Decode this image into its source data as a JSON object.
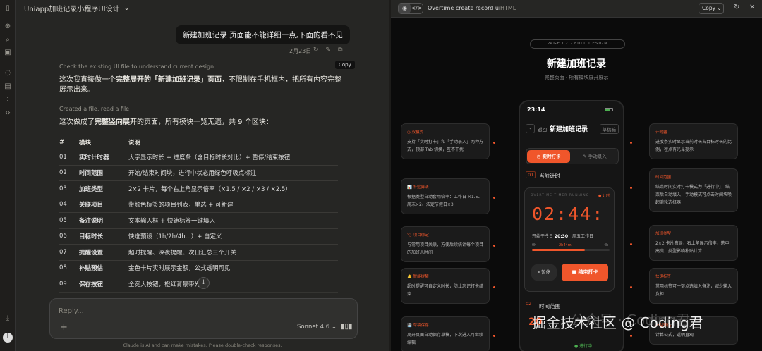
{
  "app": {
    "conversation_title": "Uniapp加班记录小程序UI设计",
    "user_message": "新建加班记录 页面能不能详细一点,下面的看不见",
    "message_date": "2月23日",
    "tooltip": "Copy",
    "step1": "Check the existing UI file to understand current design",
    "para1_a": "这次我直接做一个",
    "para1_b": "完整展开的「新建加班记录」页面",
    "para1_c": "，不限制在手机框内，把所有内容完整展示出来。",
    "step2": "Created a file, read a file",
    "para2_a": "这次做成了",
    "para2_b": "完整竖向展开",
    "para2_c": "的页面，所有模块一览无遗，共 9 个区块：",
    "table": {
      "headers": [
        "#",
        "模块",
        "说明"
      ],
      "rows": [
        [
          "01",
          "实时计时器",
          "大字显示时长 + 进度条（含目标时长对比）+ 暂停/结束按钮"
        ],
        [
          "02",
          "时间范围",
          "开始/结束时间块，进行中状态用绿色呼吸点标注"
        ],
        [
          "03",
          "加班类型",
          "2×2 卡片，每个右上角显示倍率（×1.5 / ×2 / ×3 / ×2.5）"
        ],
        [
          "04",
          "关联项目",
          "带颜色标签的项目列表，单选 + 可新建"
        ],
        [
          "05",
          "备注说明",
          "文本输入框 + 快速标签一键填入"
        ],
        [
          "06",
          "目标时长",
          "快选预设（1h/2h/4h...）+ 自定义"
        ],
        [
          "07",
          "提醒设置",
          "超时提醒、深夜提醒、次日汇总三个开关"
        ],
        [
          "08",
          "补贴预估",
          "金色卡片实时展示金额，公式透明可见"
        ],
        [
          "09",
          "保存按钮",
          "全宽大按钮，橙红背景带光晕"
        ]
      ]
    },
    "input_placeholder": "Reply...",
    "model": "Sonnet 4.6 ⌄",
    "disclaimer": "Claude is AI and can make mistakes. Please double-check responses."
  },
  "preview": {
    "title": "Overtime create record ui",
    "kind": "HTML",
    "toggle": [
      "◉",
      "</>"
    ],
    "copy_label": "Copy ⌄",
    "pill": "PAGE 02 · FULL DESIGN",
    "heading": "新建加班记录",
    "subheading": "完整页面 · 所有模块展开展示",
    "phone": {
      "time": "23:14",
      "back": "返回",
      "title": "新建加班记录",
      "draft": "草稿箱",
      "tab_live": "◷ 实时打卡",
      "tab_manual": "✎ 手动录入",
      "sec1_num": "01",
      "sec1_title": "当前计时",
      "timer_label": "OVERTIME TIMER RUNNING",
      "timer_status": "● 计时",
      "timer": "02:44:",
      "start_pre": "开始于今日 ",
      "start_time": "20:30",
      "start_post": "，周五工作日",
      "bar_mid": "2h44m",
      "bar_end": "4h",
      "bar_start": "0h",
      "progress_percent": 68,
      "pause": "⏸ 暂停",
      "end": "■ 结束打卡",
      "sec2_num": "02",
      "sec2_title": "时间范围",
      "start_val": "20",
      "going": "● 进行中"
    },
    "notes_left": [
      {
        "head": "◷ 双模式",
        "body": "支持「实时打卡」和「手动录入」两种方式，顶部 Tab 切换，互不干扰"
      },
      {
        "head": "📊 补贴算法",
        "body": "根据类型自动套用倍率：工作日 ×1.5、周末×2、法定节假日×3"
      },
      {
        "head": "🏷 项目绑定",
        "body": "与常用项目关联，方便后续统计每个项目的加班总时间"
      },
      {
        "head": "🔔 智能提醒",
        "body": "超时提醒可自定义时长，防止忘记打卡结束"
      },
      {
        "head": "💾 草稿保存",
        "body": "离开页面自动保存草稿，下次进入可继续编辑"
      }
    ],
    "notes_right": [
      {
        "head": "计时器",
        "body": "进度条实时显示当前时长占目标时长的比例，橙点有光晕提示"
      },
      {
        "head": "时间范围",
        "body": "结束时间实时打卡模式为「进行中」，结束后自动填入；手动模式可点击时间块唤起滚轮选择器"
      },
      {
        "head": "加班类型",
        "body": "2×2 卡片布局，右上角展示倍率，选中高亮；类型影响补贴计算"
      },
      {
        "head": "快速标签",
        "body": "常用标签可一键点选填入备注，减少输入负担"
      },
      {
        "head": "补贴预估",
        "body": "计算公式，透明直观"
      }
    ],
    "watermark": "掘金技术社区 @ Coding君",
    "watermark2": "公众号 · Coding君"
  }
}
